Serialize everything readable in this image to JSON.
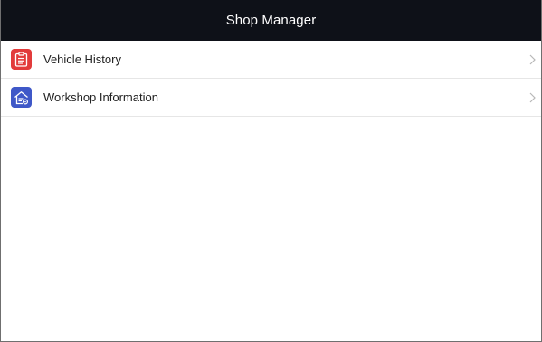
{
  "header": {
    "title": "Shop Manager"
  },
  "menu": {
    "items": [
      {
        "label": "Vehicle History",
        "icon": "clipboard-icon",
        "icon_color": "#e23b3b"
      },
      {
        "label": "Workshop Information",
        "icon": "workshop-house-icon",
        "icon_color": "#3f58c8"
      }
    ]
  },
  "colors": {
    "title_bar": "#0e1118",
    "divider": "#e6e6e6",
    "chevron": "#b8b8b8"
  }
}
